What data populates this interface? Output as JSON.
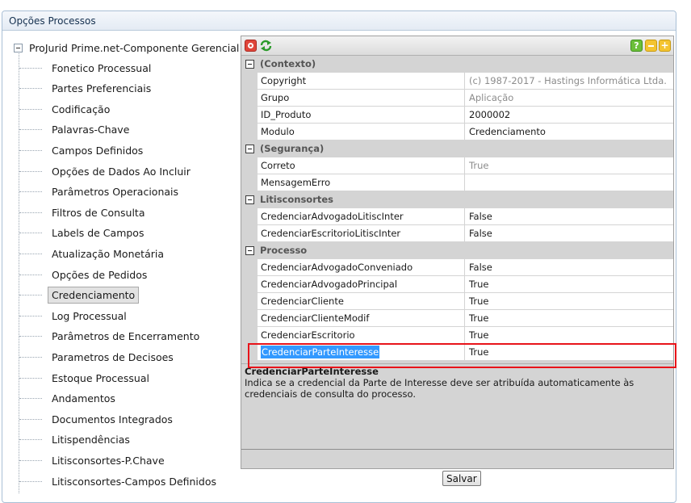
{
  "panel": {
    "title": "Opções Processos"
  },
  "tree": {
    "root_label": "ProJurid Prime.net-Componente Gerencial",
    "items": [
      "Fonetico Processual",
      "Partes Preferenciais",
      "Codificação",
      "Palavras-Chave",
      "Campos Definidos",
      "Opções de Dados Ao Incluir",
      "Parâmetros Operacionais",
      "Filtros de Consulta",
      "Labels de Campos",
      "Atualização Monetária",
      "Opções de Pedidos",
      "Credenciamento",
      "Log Processual",
      "Parâmetros de Encerramento",
      "Parametros de Decisoes",
      "Estoque Processual",
      "Andamentos",
      "Documentos Integrados",
      "Litispendências",
      "Litisconsortes-P.Chave",
      "Litisconsortes-Campos Definidos"
    ],
    "selected": "Credenciamento"
  },
  "toolbar": {
    "icons": [
      "close-red-icon",
      "refresh-icon",
      "help-icon",
      "minimize-icon",
      "add-icon"
    ],
    "help_glyph": "?"
  },
  "grid": {
    "categories": [
      {
        "label": "(Contexto)",
        "props": [
          {
            "name": "Copyright",
            "value": "(c) 1987-2017 - Hastings Informática Ltda.",
            "readonly": true
          },
          {
            "name": "Grupo",
            "value": "Aplicação",
            "readonly": true
          },
          {
            "name": "ID_Produto",
            "value": "2000002",
            "readonly": false
          },
          {
            "name": "Modulo",
            "value": "Credenciamento",
            "readonly": false
          }
        ]
      },
      {
        "label": "(Segurança)",
        "props": [
          {
            "name": "Correto",
            "value": "True",
            "readonly": true
          },
          {
            "name": "MensagemErro",
            "value": "",
            "readonly": false
          }
        ]
      },
      {
        "label": "Litisconsortes",
        "props": [
          {
            "name": "CredenciarAdvogadoLitiscInter",
            "value": "False",
            "readonly": false
          },
          {
            "name": "CredenciarEscritorioLitiscInter",
            "value": "False",
            "readonly": false
          }
        ]
      },
      {
        "label": "Processo",
        "props": [
          {
            "name": "CredenciarAdvogadoConveniado",
            "value": "False",
            "readonly": false
          },
          {
            "name": "CredenciarAdvogadoPrincipal",
            "value": "True",
            "readonly": false
          },
          {
            "name": "CredenciarCliente",
            "value": "True",
            "readonly": false
          },
          {
            "name": "CredenciarClienteModif",
            "value": "True",
            "readonly": false
          },
          {
            "name": "CredenciarEscritorio",
            "value": "True",
            "readonly": false
          },
          {
            "name": "CredenciarParteInteresse",
            "value": "True",
            "readonly": false,
            "selected": true
          }
        ]
      }
    ],
    "description": {
      "title": "CredenciarParteInteresse",
      "text": "Indica se a credencial da Parte de Interesse deve ser atribuída automaticamente às credenciais de consulta do processo."
    }
  },
  "buttons": {
    "save": "Salvar"
  },
  "colors": {
    "selection": "#3399ff",
    "highlight_box": "#e8141a",
    "panel_border": "#a9bfd6"
  }
}
